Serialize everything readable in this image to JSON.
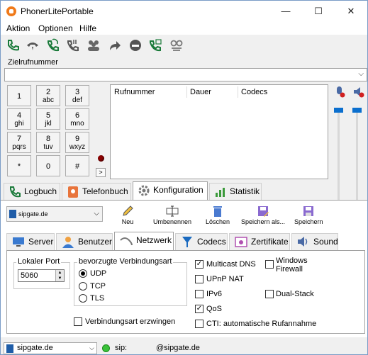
{
  "window": {
    "title": "PhonerLitePortable",
    "controls": [
      "—",
      "☐",
      "✕"
    ]
  },
  "menu": [
    "Aktion",
    "Optionen",
    "Hilfe"
  ],
  "toolbar_icons": [
    "call-icon",
    "hold-icon",
    "transfer-icon",
    "redial-icon",
    "conference-icon",
    "forward-icon",
    "dnd-icon",
    "callback-icon",
    "voicemail-icon"
  ],
  "zielrufnummer": {
    "label": "Zielrufnummer",
    "value": ""
  },
  "keypad": [
    {
      "d": "1",
      "l": ""
    },
    {
      "d": "2",
      "l": "abc"
    },
    {
      "d": "3",
      "l": "def"
    },
    {
      "d": "4",
      "l": "ghi"
    },
    {
      "d": "5",
      "l": "jkl"
    },
    {
      "d": "6",
      "l": "mno"
    },
    {
      "d": "7",
      "l": "pqrs"
    },
    {
      "d": "8",
      "l": "tuv"
    },
    {
      "d": "9",
      "l": "wxyz"
    },
    {
      "d": "*",
      "l": ""
    },
    {
      "d": "0",
      "l": ""
    },
    {
      "d": "#",
      "l": ""
    }
  ],
  "calllist": {
    "columns": [
      "Rufnummer",
      "Dauer",
      "Codecs"
    ]
  },
  "main_tabs": [
    "Logbuch",
    "Telefonbuch",
    "Konfiguration",
    "Statistik"
  ],
  "config": {
    "account": "sipgate.de",
    "buttons": [
      "Neu",
      "Umbenennen",
      "Löschen",
      "Speichern als...",
      "Speichern"
    ],
    "sub_tabs": [
      "Server",
      "Benutzer",
      "Netzwerk",
      "Codecs",
      "Zertifikate",
      "Sound"
    ]
  },
  "netzwerk": {
    "local_port_label": "Lokaler Port",
    "local_port": "5060",
    "conn_label": "bevorzugte Verbindungsart",
    "conn_options": [
      "UDP",
      "TCP",
      "TLS"
    ],
    "conn_selected": "UDP",
    "force_label": "Verbindungsart erzwingen",
    "force_checked": false,
    "options": [
      {
        "label": "Multicast DNS",
        "checked": true
      },
      {
        "label": "UPnP NAT",
        "checked": false
      },
      {
        "label": "IPv6",
        "checked": false
      },
      {
        "label": "QoS",
        "checked": true
      },
      {
        "label": "CTI: automatische Rufannahme",
        "checked": false
      },
      {
        "label": "Windows Firewall",
        "checked": false
      },
      {
        "label": "Dual-Stack",
        "checked": false
      }
    ]
  },
  "status": {
    "account": "sipgate.de",
    "sip_label": "sip:",
    "sip_value": "@sipgate.de",
    "online_color": "#3ac23a"
  }
}
